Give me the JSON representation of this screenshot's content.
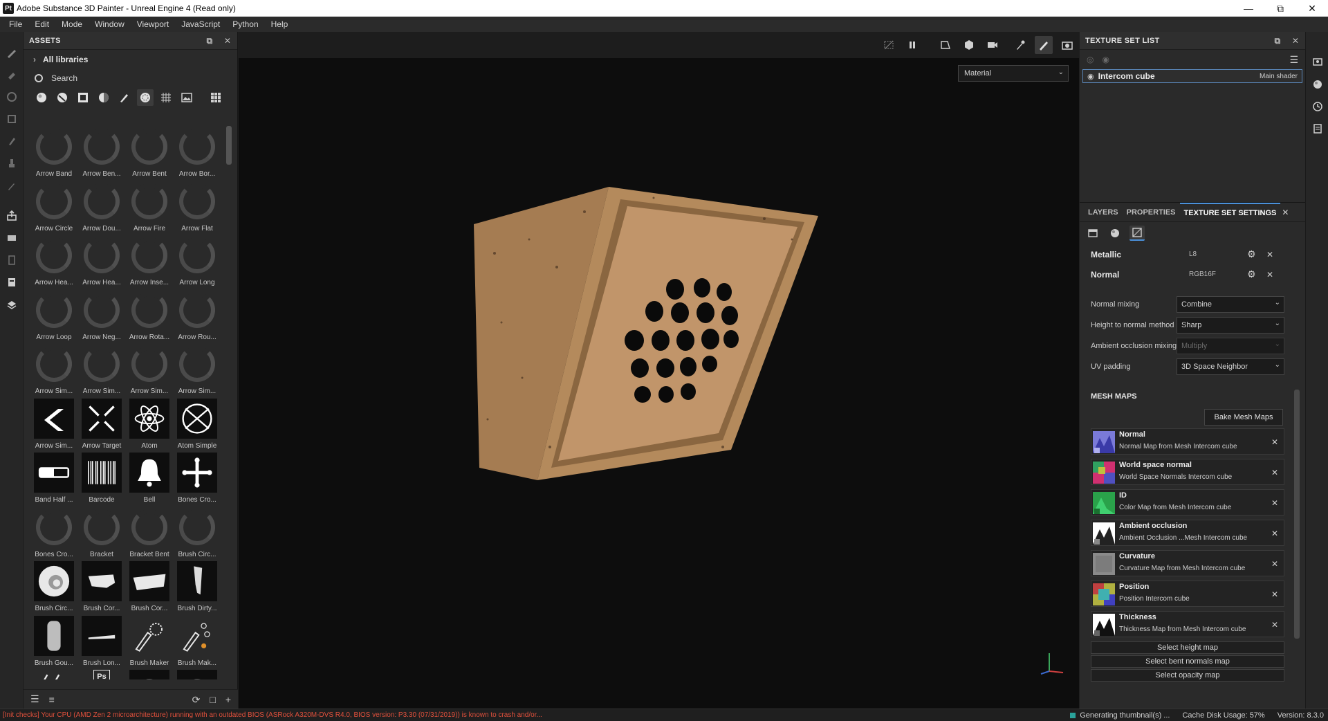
{
  "window": {
    "app_icon": "Pt",
    "title": "Adobe Substance 3D Painter - Unreal Engine 4 (Read only)",
    "controls": [
      "minimize-icon",
      "maximize-icon",
      "close-icon"
    ]
  },
  "menu": [
    "File",
    "Edit",
    "Mode",
    "Window",
    "Viewport",
    "JavaScript",
    "Python",
    "Help"
  ],
  "toolstrip": [
    "paint-brush-icon",
    "eraser-icon",
    "projection-icon",
    "geometry-mask-icon",
    "smudge-icon",
    "clone-stamp-icon",
    "color-picker-icon",
    "export-icon",
    "bake-icon",
    "texture-set-icon",
    "document-icon",
    "shelf-icon"
  ],
  "assets": {
    "title": "ASSETS",
    "libraries_label": "All libraries",
    "search_placeholder": "Search",
    "filters": [
      "materials-filter-icon",
      "smart-materials-filter-icon",
      "masks-filter-icon",
      "generators-filter-icon",
      "brushes-filter-icon",
      "alphas-filter-icon",
      "grunges-filter-icon",
      "environments-filter-icon",
      "grid-view-icon"
    ],
    "items": [
      {
        "label": "Arrow Band",
        "kind": "loading"
      },
      {
        "label": "Arrow Ben...",
        "kind": "loading"
      },
      {
        "label": "Arrow Bent",
        "kind": "loading"
      },
      {
        "label": "Arrow Bor...",
        "kind": "loading"
      },
      {
        "label": "Arrow Circle",
        "kind": "loading"
      },
      {
        "label": "Arrow Dou...",
        "kind": "loading"
      },
      {
        "label": "Arrow Fire",
        "kind": "loading"
      },
      {
        "label": "Arrow Flat",
        "kind": "loading"
      },
      {
        "label": "Arrow Hea...",
        "kind": "loading"
      },
      {
        "label": "Arrow Hea...",
        "kind": "loading"
      },
      {
        "label": "Arrow Inse...",
        "kind": "loading"
      },
      {
        "label": "Arrow Long",
        "kind": "loading"
      },
      {
        "label": "Arrow Loop",
        "kind": "loading"
      },
      {
        "label": "Arrow Neg...",
        "kind": "loading"
      },
      {
        "label": "Arrow Rota...",
        "kind": "loading"
      },
      {
        "label": "Arrow Rou...",
        "kind": "loading"
      },
      {
        "label": "Arrow Sim...",
        "kind": "loading"
      },
      {
        "label": "Arrow Sim...",
        "kind": "loading"
      },
      {
        "label": "Arrow Sim...",
        "kind": "loading"
      },
      {
        "label": "Arrow Sim...",
        "kind": "loading"
      },
      {
        "label": "Arrow Sim...",
        "kind": "chevron"
      },
      {
        "label": "Arrow Target",
        "kind": "target"
      },
      {
        "label": "Atom",
        "kind": "atom"
      },
      {
        "label": "Atom Simple",
        "kind": "atom-simple"
      },
      {
        "label": "Band Half ...",
        "kind": "band"
      },
      {
        "label": "Barcode",
        "kind": "barcode"
      },
      {
        "label": "Bell",
        "kind": "bell"
      },
      {
        "label": "Bones Cro...",
        "kind": "bones"
      },
      {
        "label": "Bones Cro...",
        "kind": "loading"
      },
      {
        "label": "Bracket",
        "kind": "loading"
      },
      {
        "label": "Bracket Bent",
        "kind": "loading"
      },
      {
        "label": "Brush Circ...",
        "kind": "loading"
      },
      {
        "label": "Brush Circ...",
        "kind": "swirl"
      },
      {
        "label": "Brush Cor...",
        "kind": "stroke"
      },
      {
        "label": "Brush Cor...",
        "kind": "stroke-wide"
      },
      {
        "label": "Brush Dirty...",
        "kind": "dirty"
      },
      {
        "label": "Brush Gou...",
        "kind": "gouache"
      },
      {
        "label": "Brush Lon...",
        "kind": "long"
      },
      {
        "label": "Brush Maker",
        "kind": "maker"
      },
      {
        "label": "Brush Mak...",
        "kind": "maker2"
      },
      {
        "label": "",
        "kind": "pens"
      },
      {
        "label": "",
        "kind": "ps"
      },
      {
        "label": "",
        "kind": "sphere"
      },
      {
        "label": "",
        "kind": "sphere"
      }
    ],
    "footer_left": [
      "list-view-icon",
      "detail-view-icon"
    ],
    "footer_right": [
      "refresh-icon",
      "folder-icon",
      "add-icon"
    ]
  },
  "viewport": {
    "toolbar": [
      "hide-icon",
      "pause-icon",
      "uv-view-icon",
      "3d-view-icon",
      "camera-icon",
      "dropper-icon",
      "paint-mode-icon",
      "screenshot-icon"
    ],
    "material_mode": "Material",
    "model_colors": {
      "base": "#b98c5e",
      "dark": "#6b4a2c",
      "hole": "#0a0a0a"
    }
  },
  "texture_set_list": {
    "title": "TEXTURE SET LIST",
    "item_name": "Intercom cube",
    "item_shader": "Main shader"
  },
  "properties": {
    "tabs": [
      "LAYERS",
      "PROPERTIES",
      "TEXTURE SET SETTINGS"
    ],
    "active_tab": "TEXTURE SET SETTINGS",
    "channels": [
      {
        "name": "Metallic",
        "format": "L8"
      },
      {
        "name": "Normal",
        "format": "RGB16F"
      }
    ],
    "settings": [
      {
        "label": "Normal mixing",
        "value": "Combine",
        "disabled": false
      },
      {
        "label": "Height to normal method",
        "value": "Sharp",
        "disabled": false
      },
      {
        "label": "Ambient occlusion mixing",
        "value": "Multiply",
        "disabled": true
      },
      {
        "label": "UV padding",
        "value": "3D Space Neighbor",
        "disabled": false
      }
    ],
    "mesh_maps_title": "MESH MAPS",
    "bake_button": "Bake Mesh Maps",
    "mesh_maps": [
      {
        "title": "Normal",
        "sub": "Normal Map from Mesh Intercom cube",
        "thumb": "normal"
      },
      {
        "title": "World space normal",
        "sub": "World Space Normals Intercom cube",
        "thumb": "world"
      },
      {
        "title": "ID",
        "sub": "Color Map from Mesh Intercom cube",
        "thumb": "id"
      },
      {
        "title": "Ambient occlusion",
        "sub": "Ambient Occlusion ...Mesh Intercom cube",
        "thumb": "ao"
      },
      {
        "title": "Curvature",
        "sub": "Curvature Map from Mesh Intercom cube",
        "thumb": "curv"
      },
      {
        "title": "Position",
        "sub": "Position Intercom cube",
        "thumb": "pos"
      },
      {
        "title": "Thickness",
        "sub": "Thickness Map from Mesh Intercom cube",
        "thumb": "thick"
      }
    ],
    "select_buttons": [
      "Select height map",
      "Select bent normals map",
      "Select opacity map"
    ]
  },
  "status": {
    "error": "[Init checks] Your CPU (AMD Zen 2 microarchitecture) running with an outdated BIOS (ASRock A320M-DVS R4.0, BIOS version: P3.30 (07/31/2019)) is known to crash and/or...",
    "generating": "Generating thumbnail(s) ...",
    "cache": "Cache Disk Usage:   57%",
    "version": "Version: 8.3.0"
  }
}
